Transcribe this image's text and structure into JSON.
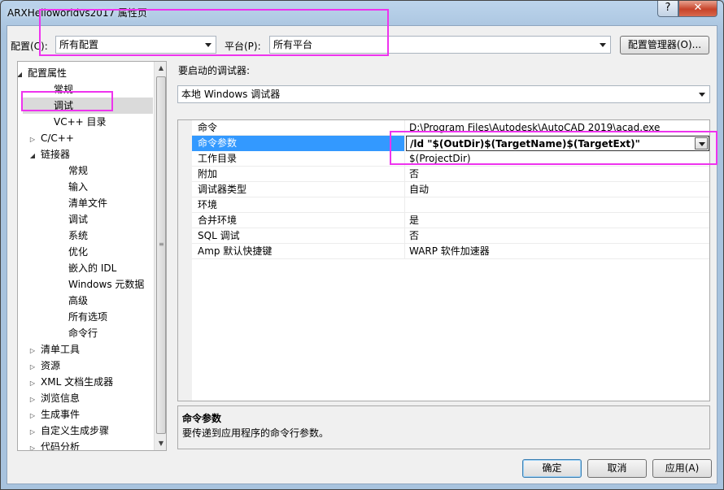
{
  "window": {
    "title": "ARXHelloworldvs2017 属性页",
    "help_glyph": "?",
    "close_glyph": "✕"
  },
  "config_bar": {
    "config_label": "配置(C):",
    "config_value": "所有配置",
    "platform_label": "平台(P):",
    "platform_value": "所有平台",
    "manager_button": "配置管理器(O)..."
  },
  "tree": {
    "items": [
      {
        "label": "配置属性",
        "expander": "◢"
      },
      {
        "label": "常规",
        "expander": ""
      },
      {
        "label": "调试",
        "expander": "",
        "selected": true
      },
      {
        "label": "VC++ 目录",
        "expander": ""
      },
      {
        "label": "C/C++",
        "expander": "▷"
      },
      {
        "label": "链接器",
        "expander": "◢"
      },
      {
        "label": "常规",
        "expander": ""
      },
      {
        "label": "输入",
        "expander": ""
      },
      {
        "label": "清单文件",
        "expander": ""
      },
      {
        "label": "调试",
        "expander": ""
      },
      {
        "label": "系统",
        "expander": ""
      },
      {
        "label": "优化",
        "expander": ""
      },
      {
        "label": "嵌入的 IDL",
        "expander": ""
      },
      {
        "label": "Windows 元数据",
        "expander": ""
      },
      {
        "label": "高级",
        "expander": ""
      },
      {
        "label": "所有选项",
        "expander": ""
      },
      {
        "label": "命令行",
        "expander": ""
      },
      {
        "label": "清单工具",
        "expander": "▷"
      },
      {
        "label": "资源",
        "expander": "▷"
      },
      {
        "label": "XML 文档生成器",
        "expander": "▷"
      },
      {
        "label": "浏览信息",
        "expander": "▷"
      },
      {
        "label": "生成事件",
        "expander": "▷"
      },
      {
        "label": "自定义生成步骤",
        "expander": "▷"
      },
      {
        "label": "代码分析",
        "expander": "▷"
      }
    ],
    "scroll_up": "▲",
    "scroll_down": "▼",
    "scroll_grip": "≡"
  },
  "debugger": {
    "label": "要启动的调试器:",
    "value": "本地 Windows 调试器"
  },
  "properties": [
    {
      "name": "命令",
      "value": "D:\\Program Files\\Autodesk\\AutoCAD 2019\\acad.exe"
    },
    {
      "name": "命令参数",
      "value": "/ld \"$(OutDir)$(TargetName)$(TargetExt)\"",
      "selected": true
    },
    {
      "name": "工作目录",
      "value": "$(ProjectDir)"
    },
    {
      "name": "附加",
      "value": "否"
    },
    {
      "name": "调试器类型",
      "value": "自动"
    },
    {
      "name": "环境",
      "value": ""
    },
    {
      "name": "合并环境",
      "value": "是"
    },
    {
      "name": "SQL 调试",
      "value": "否"
    },
    {
      "name": "Amp 默认快捷键",
      "value": "WARP 软件加速器"
    }
  ],
  "description": {
    "title": "命令参数",
    "text": "要传递到应用程序的命令行参数。"
  },
  "buttons": {
    "ok": "确定",
    "cancel": "取消",
    "apply": "应用(A)"
  },
  "colors": {
    "selection": "#3399ff",
    "annotation": "#ee33ee"
  }
}
